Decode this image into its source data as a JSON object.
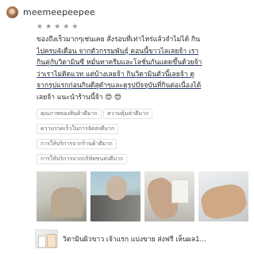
{
  "review": {
    "username": "meemeepeepee",
    "rating": 5,
    "lines": [
      "ของถึงเร็วมากๆเช่นเคย สั่งรอบที่เท่าไหร่แล้วจำไม่ได้ กิน",
      "ไปครบ4เดือน จากตัวกรรมพันธุ์ ตอนนี้ขาวไลเลยจ้า เรา",
      "กินคู่กับวิตามินซี หมั่นทาครีมและโลชั่นกันแดดขึ้นด้วยจ้า",
      "ว่าเราไม่ติดแวท แต่บ้างเลยจ้า กินวิตามินตัวนี้เลยจ้า ดู",
      "จากรูปแรกก่อนกินดีสูดำๆและดูรูปปัจจุบันที่กินต่อเนื่องได้",
      "เลยจ้า แนะนำร้านนี้จ้า 😍 😍"
    ]
  },
  "attributes": [
    "คุณภาพของสินค้าดีมาก",
    "ความคุ้มค่าดีมาก",
    "ความรวดเร็วในการจัดส่งดีมาก",
    "การให้บริการจากร้านค้าดีมาก",
    "การให้บริการจากบริษัทขนส่งดีมาก"
  ],
  "photos": [
    "photo-1",
    "photo-2",
    "photo-3",
    "photo-4"
  ],
  "product": {
    "title": "วิตามินผิวขาว เจ้าแรก แบ่งขาย ส่งฟรี เห็นผล1..."
  },
  "colors": {
    "star": "#9a9a9a",
    "underline": "#2c3f7a",
    "chip_border": "#e2e2e2"
  }
}
